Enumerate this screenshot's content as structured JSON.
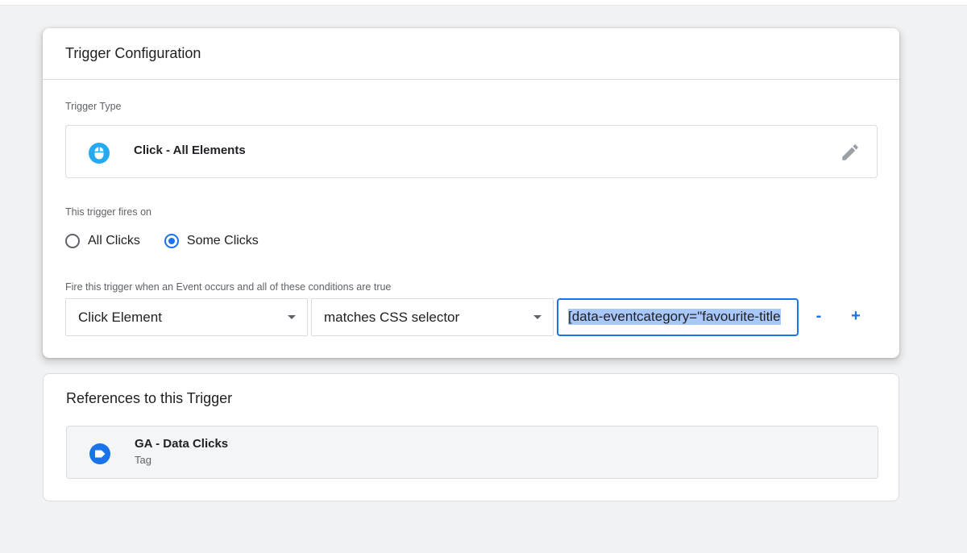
{
  "trigger_config": {
    "title": "Trigger Configuration",
    "trigger_type_label": "Trigger Type",
    "trigger_type": {
      "name": "Click - All Elements",
      "icon": "mouse-icon",
      "icon_color": "#25a9f0"
    },
    "fires_on_label": "This trigger fires on",
    "fires_on_options": [
      {
        "label": "All Clicks",
        "selected": false
      },
      {
        "label": "Some Clicks",
        "selected": true
      }
    ],
    "conditions_label": "Fire this trigger when an Event occurs and all of these conditions are true",
    "condition": {
      "variable": "Click Element",
      "operator": "matches CSS selector",
      "value": "[data-eventcategory=\"favourite-title"
    },
    "remove_label": "-",
    "add_label": "+"
  },
  "references": {
    "title": "References to this Trigger",
    "items": [
      {
        "name": "GA - Data Clicks",
        "type": "Tag",
        "icon": "tag-icon",
        "icon_color": "#1a73e8"
      }
    ]
  },
  "colors": {
    "accent": "#1a73e8",
    "background": "#f1f2f4"
  }
}
